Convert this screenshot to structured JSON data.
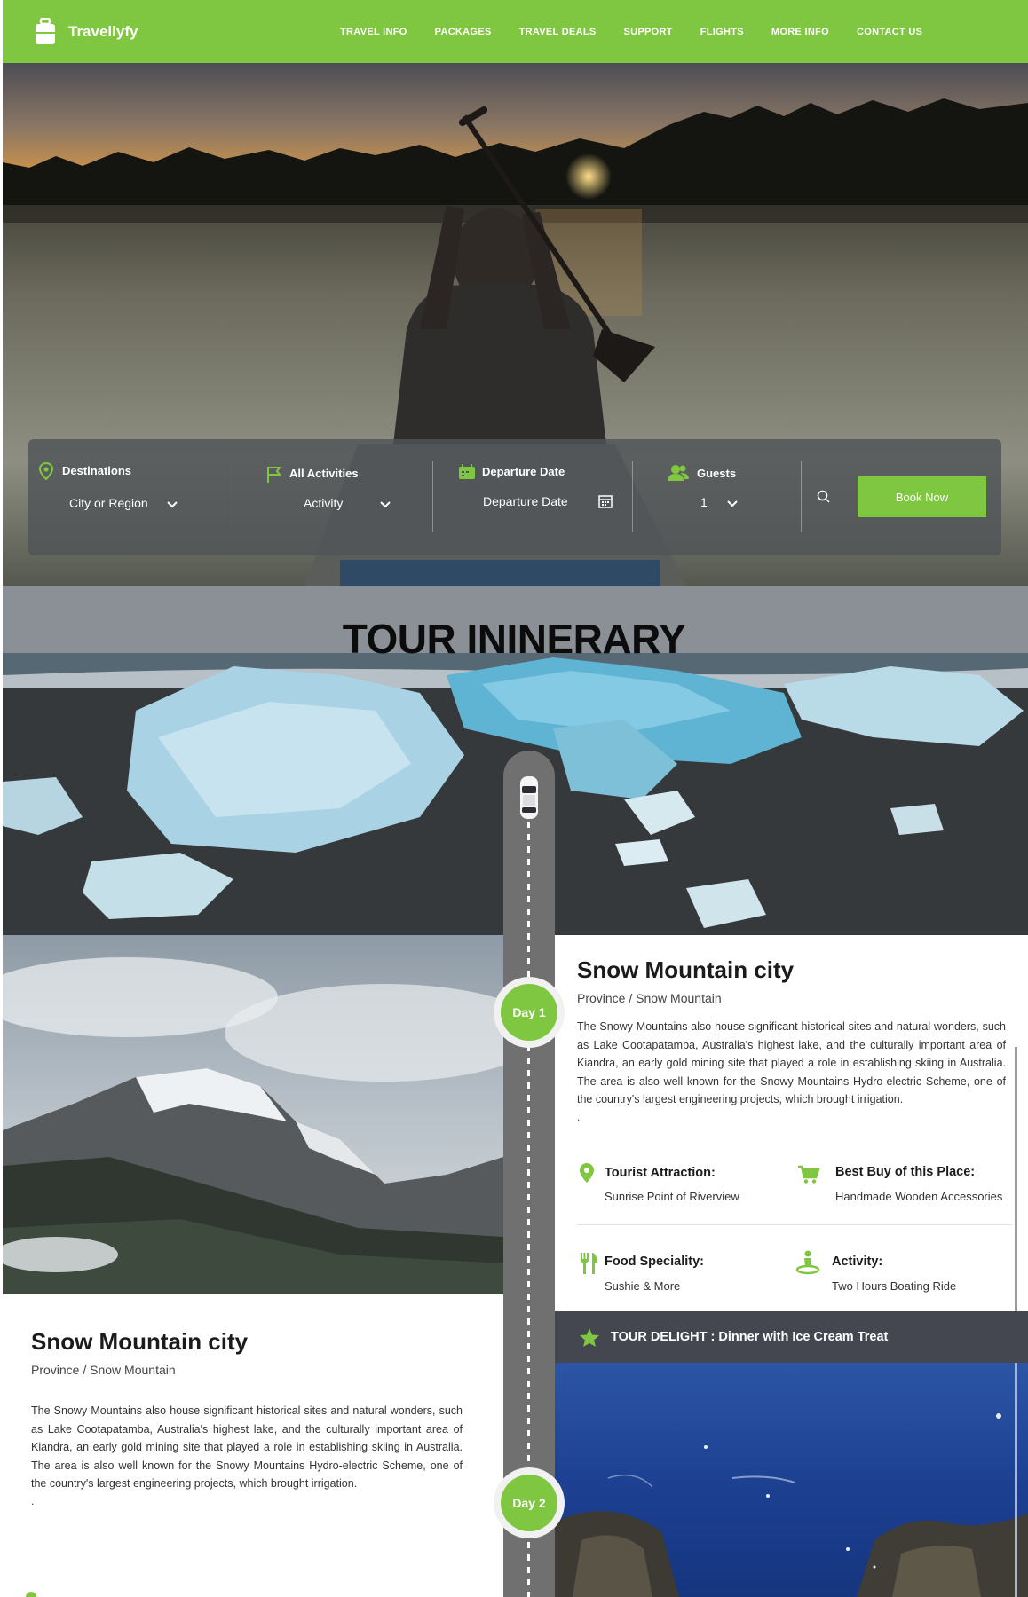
{
  "brand": {
    "name": "Travellyfy"
  },
  "nav": {
    "items": [
      "TRAVEL INFO",
      "PACKAGES",
      "TRAVEL DEALS",
      "SUPPORT",
      "FLIGHTS",
      "MORE INFO",
      "CONTACT US"
    ]
  },
  "booking": {
    "destinations": {
      "label": "Destinations",
      "value": "City or Region"
    },
    "activities": {
      "label": "All Activities",
      "value": "Activity"
    },
    "departure": {
      "label": "Departure Date",
      "value": "Departure Date"
    },
    "guests": {
      "label": "Guests",
      "value": "1"
    },
    "book_button": "Book Now"
  },
  "itinerary": {
    "title": "TOUR ININERARY",
    "days": [
      {
        "day_label": "Day 1",
        "title": "Snow Mountain city",
        "subtitle": "Province / Snow Mountain",
        "description": "The Snowy Mountains also house significant historical sites and natural wonders, such as Lake Cootapatamba, Australia's highest lake, and the culturally important area of Kiandra, an early gold mining site that played a role in establishing skiing in Australia. The area is also well known for the Snowy Mountains Hydro-electric Scheme, one of the country's largest engineering projects, which brought irrigation.",
        "dot": ".",
        "features": {
          "tourist_attraction": {
            "title": "Tourist Attraction:",
            "value": "Sunrise Point of Riverview"
          },
          "best_buy": {
            "title": "Best Buy of this Place:",
            "value": "Handmade Wooden Accessories"
          },
          "food": {
            "title": "Food Speciality:",
            "value": "Sushie & More"
          },
          "activity": {
            "title": "Activity:",
            "value": "Two Hours Boating Ride"
          }
        },
        "delight": "TOUR DELIGHT : Dinner with Ice Cream Treat"
      },
      {
        "day_label": "Day 2",
        "title": "Snow Mountain city",
        "subtitle": "Province / Snow Mountain",
        "description": "The Snowy Mountains also house significant historical sites and natural wonders, such as Lake Cootapatamba, Australia's highest lake, and the culturally important area of Kiandra, an early gold mining site that played a role in establishing skiing in Australia. The area is also well known for the Snowy Mountains Hydro-electric Scheme, one of the country's largest engineering projects, which brought irrigation.",
        "dot": "."
      }
    ]
  },
  "colors": {
    "accent": "#7fc740",
    "dark_band": "#44474f",
    "road": "#707070"
  },
  "icons": [
    "suitcase-icon",
    "location-pin-icon",
    "flag-icon",
    "calendar-icon",
    "users-icon",
    "chevron-down-icon",
    "search-icon",
    "car-icon",
    "cart-icon",
    "fork-knife-icon",
    "person-icon",
    "star-icon"
  ]
}
